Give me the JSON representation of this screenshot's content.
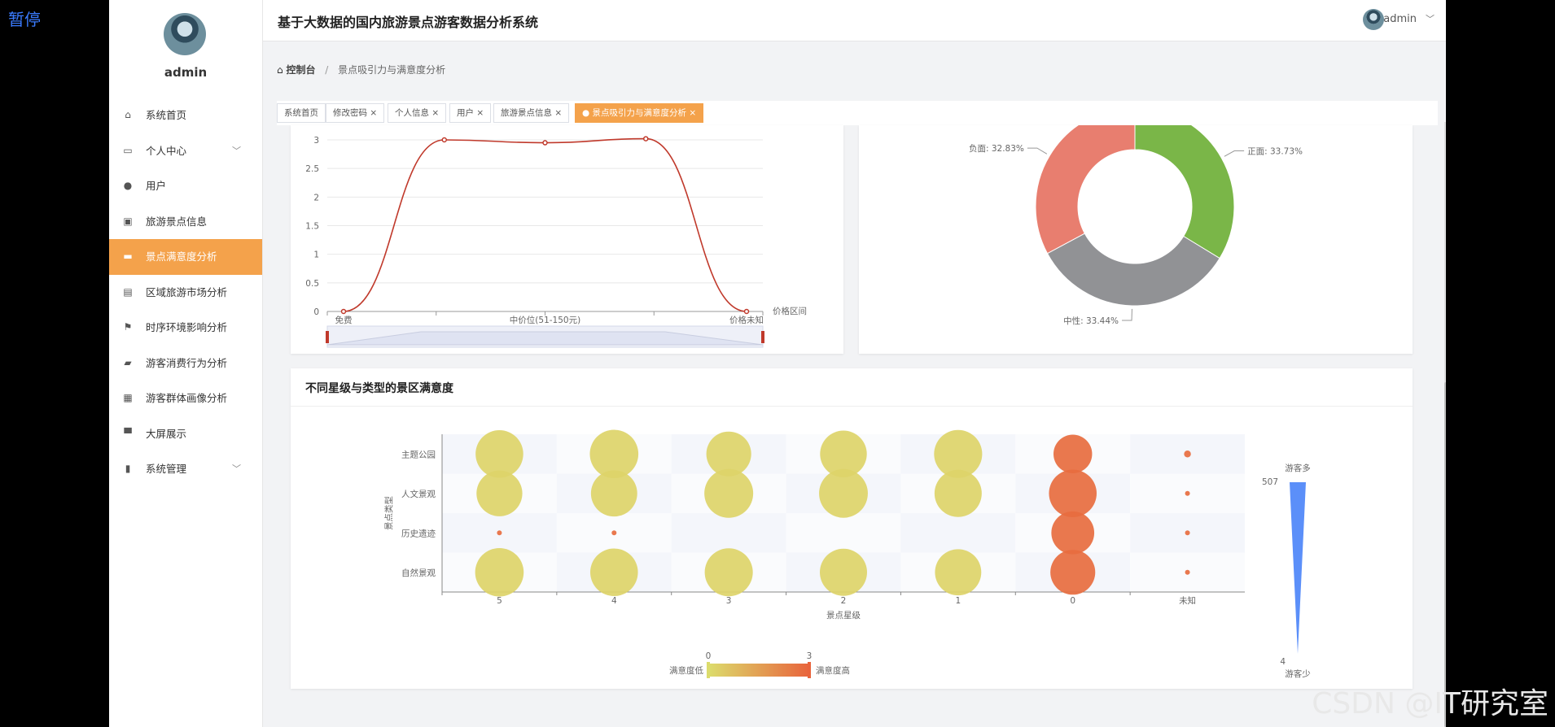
{
  "overlay": {
    "pause_label": "暂停",
    "watermark": "CSDN @IT研究室"
  },
  "sidebar": {
    "username": "admin",
    "items": [
      {
        "label": "系统首页",
        "icon": "home-icon"
      },
      {
        "label": "个人中心",
        "icon": "id-card-icon",
        "has_submenu": true
      },
      {
        "label": "用户",
        "icon": "user-pin-icon"
      },
      {
        "label": "旅游景点信息",
        "icon": "clipboard-icon"
      },
      {
        "label": "景点满意度分析",
        "icon": "briefcase-icon",
        "active": true
      },
      {
        "label": "区域旅游市场分析",
        "icon": "document-icon"
      },
      {
        "label": "时序环境影响分析",
        "icon": "flag-icon"
      },
      {
        "label": "游客消费行为分析",
        "icon": "ticket-icon"
      },
      {
        "label": "游客群体画像分析",
        "icon": "grid-icon"
      },
      {
        "label": "大屏展示",
        "icon": "monitor-icon"
      },
      {
        "label": "系统管理",
        "icon": "bar-chart-icon",
        "has_submenu": true
      }
    ]
  },
  "header": {
    "title": "基于大数据的国内旅游景点游客数据分析系统",
    "user": "admin"
  },
  "breadcrumb": {
    "home": "控制台",
    "separator": "/",
    "current": "景点吸引力与满意度分析"
  },
  "tabs": [
    {
      "label": "系统首页",
      "closable": false
    },
    {
      "label": "修改密码",
      "closable": true
    },
    {
      "label": "个人信息",
      "closable": true
    },
    {
      "label": "用户",
      "closable": true
    },
    {
      "label": "旅游景点信息",
      "closable": true
    },
    {
      "label": "景点吸引力与满意度分析",
      "closable": true,
      "active": true
    }
  ],
  "colors": {
    "accent": "#f4a24b",
    "line": "#c0392b",
    "positive": "#7ab648",
    "neutral": "#919295",
    "negative": "#e87e6f",
    "slider_fill": "#5b8ff9"
  },
  "chart_data": [
    {
      "type": "line",
      "categories": [
        "免费",
        "",
        "中价位(51-150元)",
        "",
        "价格未知"
      ],
      "values": [
        0,
        3,
        2.95,
        3.02,
        0
      ],
      "xlabel": "价格区间",
      "ylim": [
        0,
        3
      ],
      "yticks": [
        "0",
        "0.5",
        "1",
        "1.5",
        "2",
        "2.5",
        "3"
      ],
      "dataZoom": true
    },
    {
      "type": "pie",
      "donut": true,
      "slices": [
        {
          "name": "正面",
          "value": 33.73,
          "label": "正面: 33.73%"
        },
        {
          "name": "中性",
          "value": 33.44,
          "label": "中性: 33.44%"
        },
        {
          "name": "负面",
          "value": 32.83,
          "label": "负面: 32.83%"
        }
      ]
    },
    {
      "type": "scatter",
      "title": "不同星级与类型的景区满意度",
      "xlabel": "景点星级",
      "ylabel": "景点类型",
      "x_categories": [
        "5",
        "4",
        "3",
        "2",
        "1",
        "0",
        "未知"
      ],
      "y_categories": [
        "主题公园",
        "人文景观",
        "历史遗迹",
        "自然景观"
      ],
      "points": [
        {
          "x": "5",
          "y": "主题公园",
          "size": 480,
          "satisfaction": 0.2
        },
        {
          "x": "4",
          "y": "主题公园",
          "size": 500,
          "satisfaction": 0.2
        },
        {
          "x": "3",
          "y": "主题公园",
          "size": 420,
          "satisfaction": 0.2
        },
        {
          "x": "2",
          "y": "主题公园",
          "size": 460,
          "satisfaction": 0.2
        },
        {
          "x": "1",
          "y": "主题公园",
          "size": 490,
          "satisfaction": 0.2
        },
        {
          "x": "0",
          "y": "主题公园",
          "size": 300,
          "satisfaction": 2.8
        },
        {
          "x": "未知",
          "y": "主题公园",
          "size": 5,
          "satisfaction": 2.8
        },
        {
          "x": "5",
          "y": "人文景观",
          "size": 440,
          "satisfaction": 0.2
        },
        {
          "x": "4",
          "y": "人文景观",
          "size": 450,
          "satisfaction": 0.2
        },
        {
          "x": "3",
          "y": "人文景观",
          "size": 507,
          "satisfaction": 0.2
        },
        {
          "x": "2",
          "y": "人文景观",
          "size": 505,
          "satisfaction": 0.2
        },
        {
          "x": "1",
          "y": "人文景观",
          "size": 470,
          "satisfaction": 0.2
        },
        {
          "x": "0",
          "y": "人文景观",
          "size": 480,
          "satisfaction": 2.8
        },
        {
          "x": "未知",
          "y": "人文景观",
          "size": 4,
          "satisfaction": 2.8
        },
        {
          "x": "5",
          "y": "历史遗迹",
          "size": 4,
          "satisfaction": 2.8
        },
        {
          "x": "4",
          "y": "历史遗迹",
          "size": 4,
          "satisfaction": 2.8
        },
        {
          "x": "0",
          "y": "历史遗迹",
          "size": 380,
          "satisfaction": 2.8
        },
        {
          "x": "未知",
          "y": "历史遗迹",
          "size": 4,
          "satisfaction": 2.8
        },
        {
          "x": "5",
          "y": "自然景观",
          "size": 500,
          "satisfaction": 0.2
        },
        {
          "x": "4",
          "y": "自然景观",
          "size": 480,
          "satisfaction": 0.2
        },
        {
          "x": "3",
          "y": "自然景观",
          "size": 490,
          "satisfaction": 0.2
        },
        {
          "x": "2",
          "y": "自然景观",
          "size": 470,
          "satisfaction": 0.2
        },
        {
          "x": "1",
          "y": "自然景观",
          "size": 450,
          "satisfaction": 0.2
        },
        {
          "x": "0",
          "y": "自然景观",
          "size": 420,
          "satisfaction": 2.8
        },
        {
          "x": "未知",
          "y": "自然景观",
          "size": 4,
          "satisfaction": 2.8
        }
      ],
      "size_legend": {
        "max": 507,
        "min": 4,
        "max_label": "游客多",
        "min_label": "游客少"
      },
      "color_legend": {
        "min": 0,
        "max": 3,
        "low_label": "满意度低",
        "high_label": "满意度高",
        "low_color": "#dcdc6c",
        "high_color": "#e8643c"
      }
    }
  ]
}
